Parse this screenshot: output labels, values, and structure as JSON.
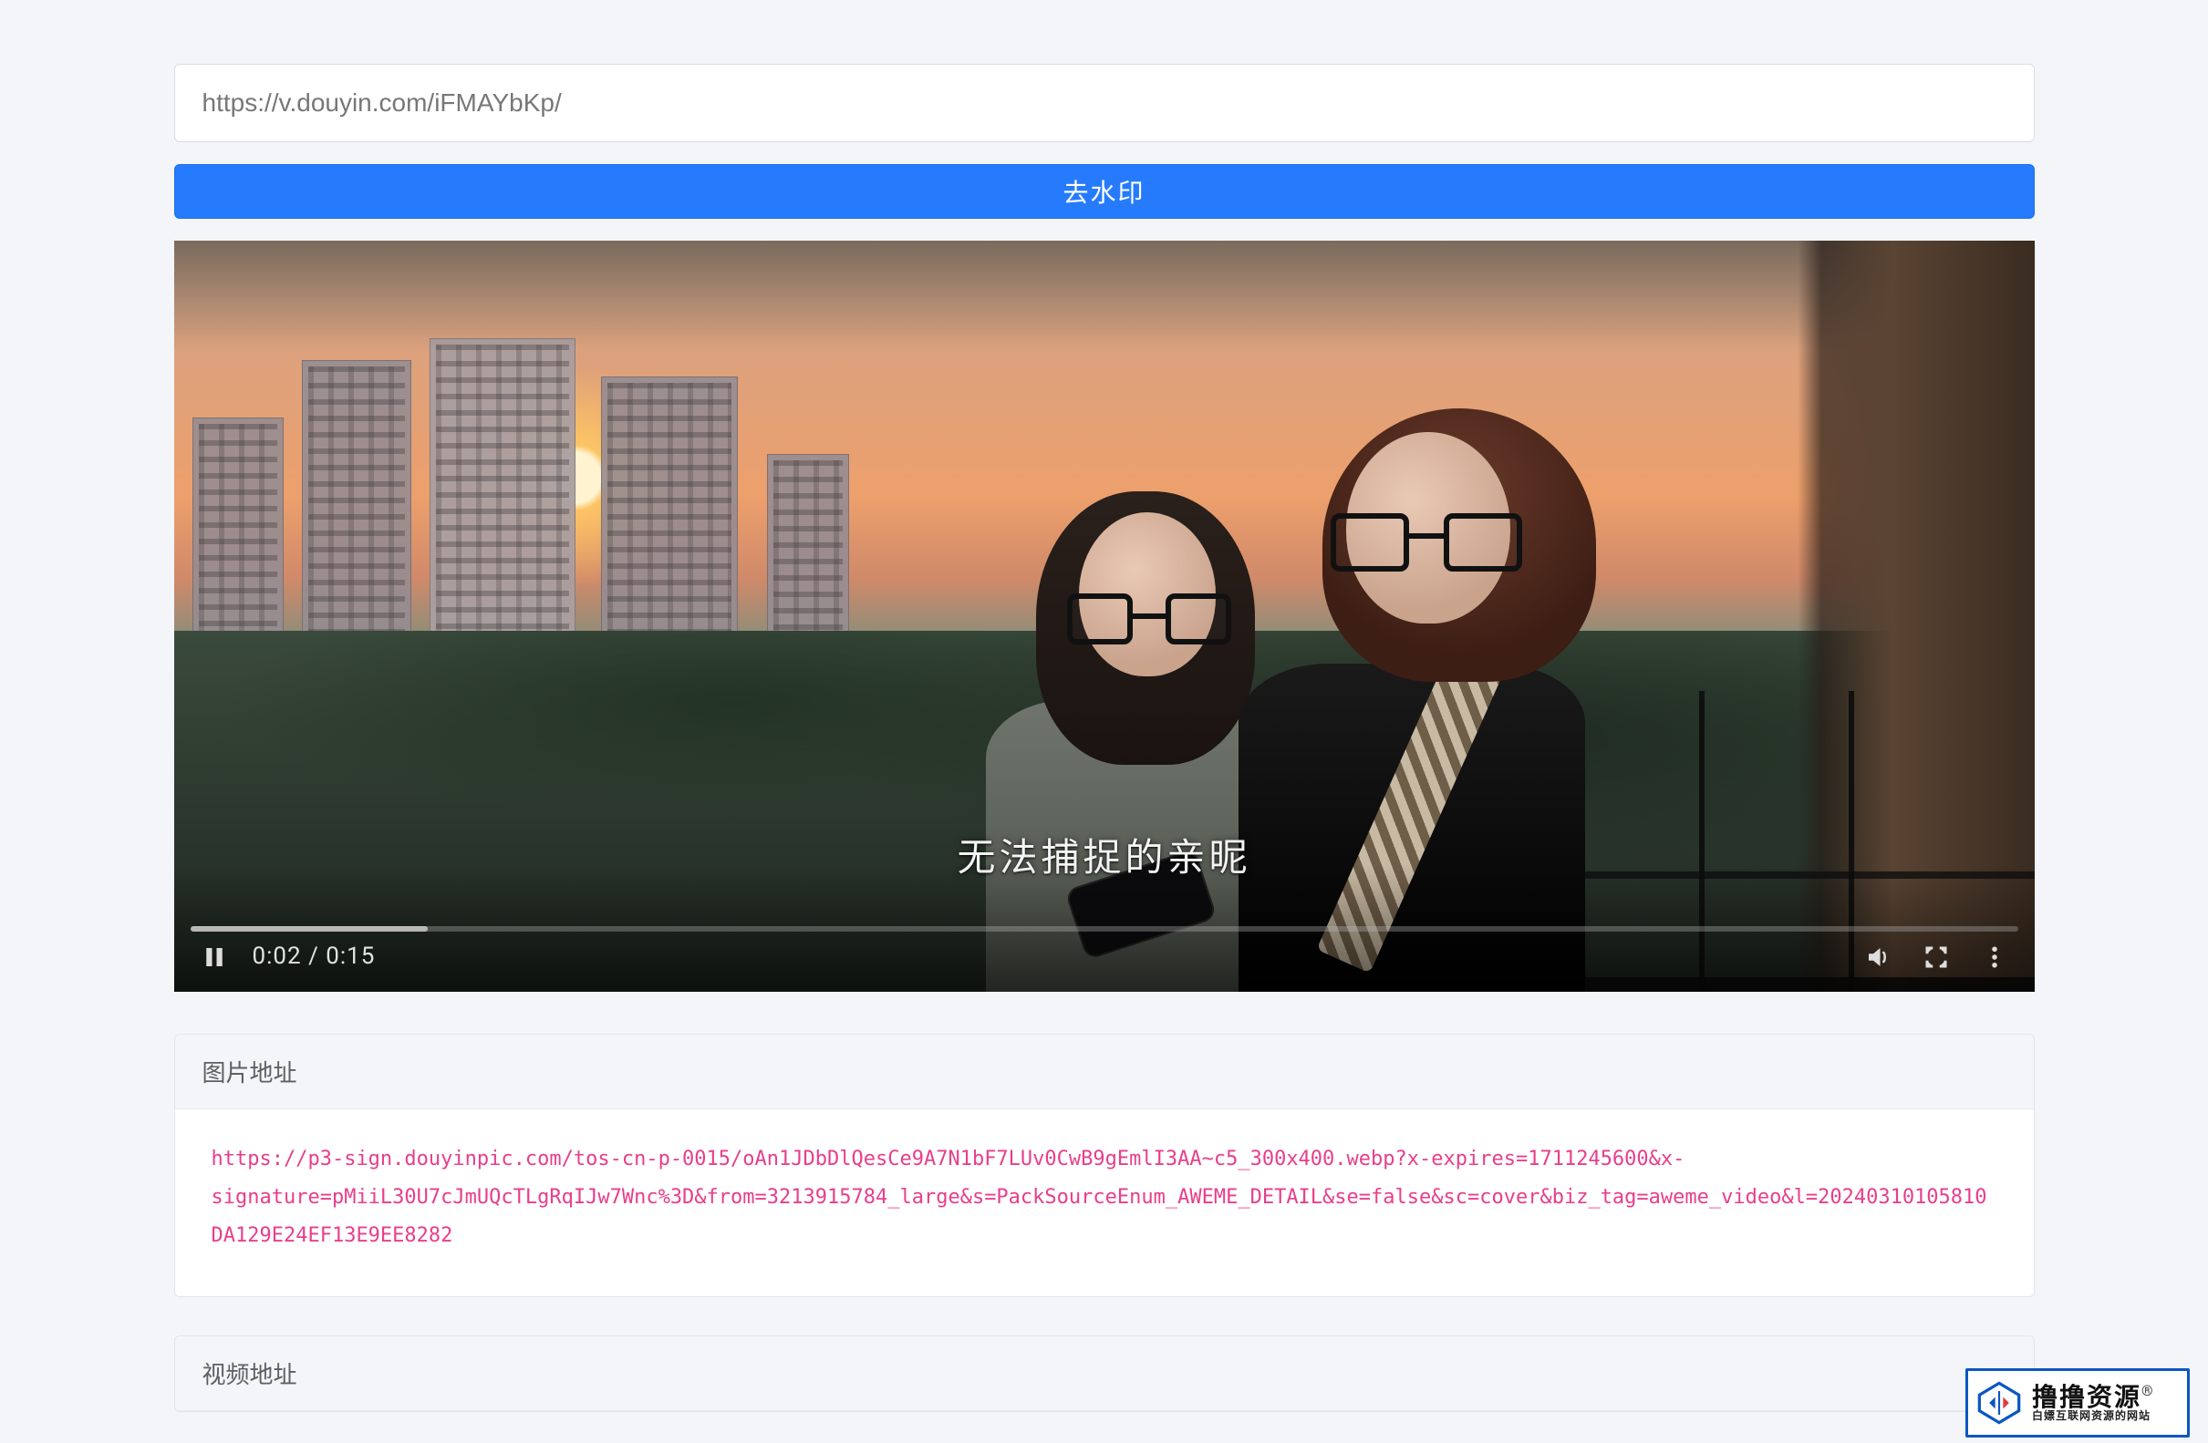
{
  "colors": {
    "primary": "#267bfd",
    "link": "#e83e8c"
  },
  "input": {
    "value": "https://v.douyin.com/iFMAYbKp/"
  },
  "buttons": {
    "submit": "去水印"
  },
  "video": {
    "time_current": "0:02",
    "time_total": "0:15",
    "time_display": "0:02 / 0:15",
    "progress_pct": 13,
    "subtitle": "无法捕捉的亲昵"
  },
  "cards": {
    "image_url": {
      "title": "图片地址",
      "link": "https://p3-sign.douyinpic.com/tos-cn-p-0015/oAn1JDbDlQesCe9A7N1bF7LUv0CwB9gEmlI3AA~c5_300x400.webp?x-expires=1711245600&x-signature=pMiiL30U7cJmUQcTLgRqIJw7Wnc%3D&from=3213915784_large&s=PackSourceEnum_AWEME_DETAIL&se=false&sc=cover&biz_tag=aweme_video&l=20240310105810DA129E24EF13E9EE8282"
    },
    "video_url": {
      "title": "视频地址"
    }
  },
  "brand": {
    "name": "撸撸资源",
    "reg": "®",
    "tagline": "白嫖互联网资源的网站"
  },
  "icons": {
    "pause": "pause-icon",
    "volume": "volume-icon",
    "fullscreen": "fullscreen-icon",
    "more": "more-icon",
    "play_small": "play-icon",
    "close_small": "close-icon"
  }
}
